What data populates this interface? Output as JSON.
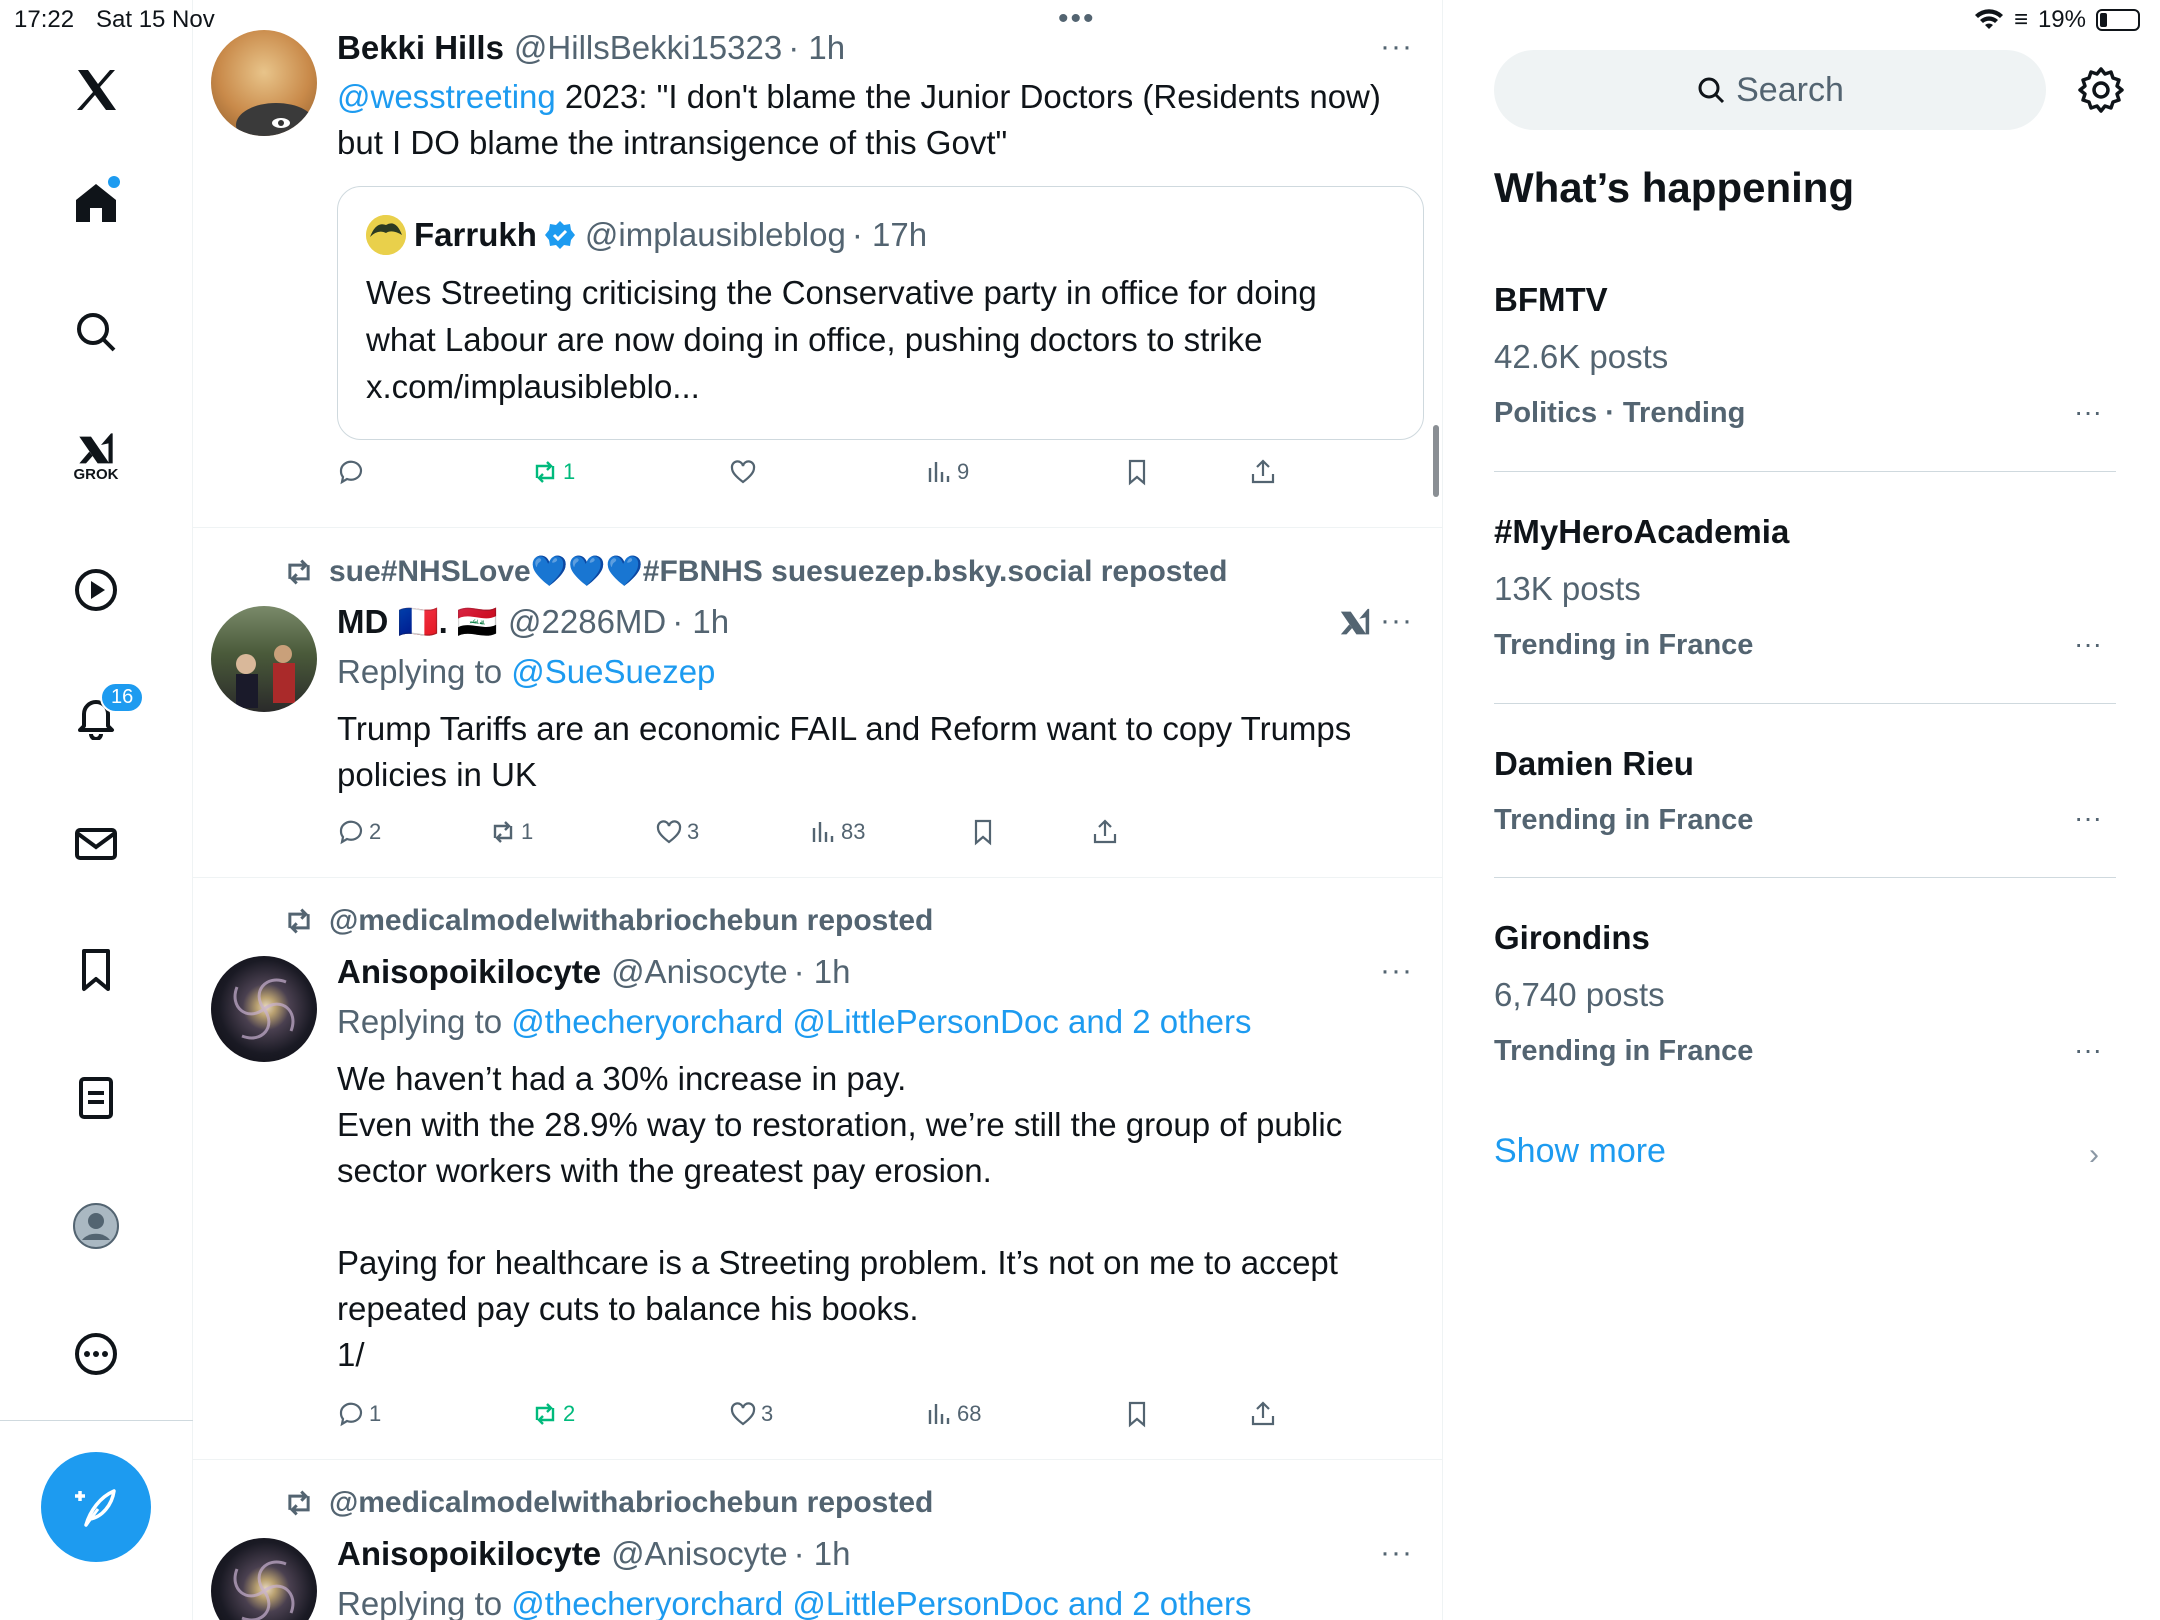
{
  "status": {
    "time": "17:22",
    "date": "Sat 15 Nov",
    "battery": "19%"
  },
  "nav": {
    "grok_label": "GROK",
    "notification_count": "16"
  },
  "feed": {
    "tweet1": {
      "name": "Bekki Hills",
      "handle": "@HillsBekki15323",
      "time": "· 1h",
      "mention": "@wesstreeting",
      "text_line1_rest": " 2023: \"I don't blame the Junior Doctors (Residents now)",
      "text_line2": "but I DO blame the intransigence of this Govt\"",
      "quote": {
        "name": "Farrukh",
        "handle": "@implausibleblog",
        "time": "· 17h",
        "line1": "Wes Streeting criticising the Conservative party in office for doing",
        "line2": "what Labour are now doing in office, pushing doctors to strike",
        "line3": "x.com/implausibleblo..."
      },
      "reposts": "1",
      "views": "9"
    },
    "tweet2": {
      "repost_by": "sue#NHSLove💙💙💙#FBNHS suesuezep.bsky.social reposted",
      "name": "MD 🇫🇷. 🇮🇶",
      "handle": "@2286MD",
      "time": "· 1h",
      "replying_prefix": "Replying to ",
      "replying_handle": "@SueSuezep",
      "text_line1": "Trump Tariffs are an economic FAIL and Reform want to copy Trumps",
      "text_line2": "policies in UK",
      "replies": "2",
      "reposts": "1",
      "likes": "3",
      "views": "83"
    },
    "tweet3": {
      "repost_by": "@medicalmodelwithabriochebun reposted",
      "name": "Anisopoikilocyte",
      "handle": "@Anisocyte",
      "time": "· 1h",
      "replying_prefix": "Replying to ",
      "replying_handles": "@thecheryorchard @LittlePersonDoc and 2 others",
      "line1": "We haven’t had a 30% increase in pay.",
      "line2": "Even with the 28.9% way to restoration, we’re still the group of public",
      "line3": "sector workers with the greatest pay erosion.",
      "line4": "Paying for healthcare is a Streeting problem. It’s not on me to accept",
      "line5": "repeated pay cuts to balance his books.",
      "line6": "1/",
      "replies": "1",
      "reposts": "2",
      "likes": "3",
      "views": "68"
    },
    "tweet4": {
      "repost_by": "@medicalmodelwithabriochebun reposted",
      "name": "Anisopoikilocyte",
      "handle": "@Anisocyte",
      "time": "· 1h",
      "replying_prefix": "Replying to ",
      "replying_handles": "@thecheryorchard @LittlePersonDoc and 2 others"
    }
  },
  "sidebar": {
    "search_placeholder": "Search",
    "title": "What’s happening",
    "trends": [
      {
        "name": "BFMTV",
        "posts": "42.6K posts",
        "category": "Politics · Trending"
      },
      {
        "name": "#MyHeroAcademia",
        "posts": "13K posts",
        "category": "Trending in France"
      },
      {
        "name": "Damien Rieu",
        "posts": "",
        "category": "Trending in France"
      },
      {
        "name": "Girondins",
        "posts": "6,740 posts",
        "category": "Trending in France"
      }
    ],
    "show_more": "Show more"
  },
  "colors": {
    "accent": "#1d9bf0",
    "repost_green": "#00ba7c",
    "muted": "#536471"
  },
  "icons": [
    "x-logo-icon",
    "home-icon",
    "search-icon",
    "grok-icon",
    "video-icon",
    "bell-icon",
    "mail-icon",
    "bookmark-icon",
    "lists-icon",
    "profile-icon",
    "more-icon",
    "compose-icon",
    "reply-icon",
    "repost-icon",
    "like-icon",
    "views-icon",
    "share-icon",
    "gear-icon",
    "verified-icon",
    "chevron-right-icon"
  ]
}
